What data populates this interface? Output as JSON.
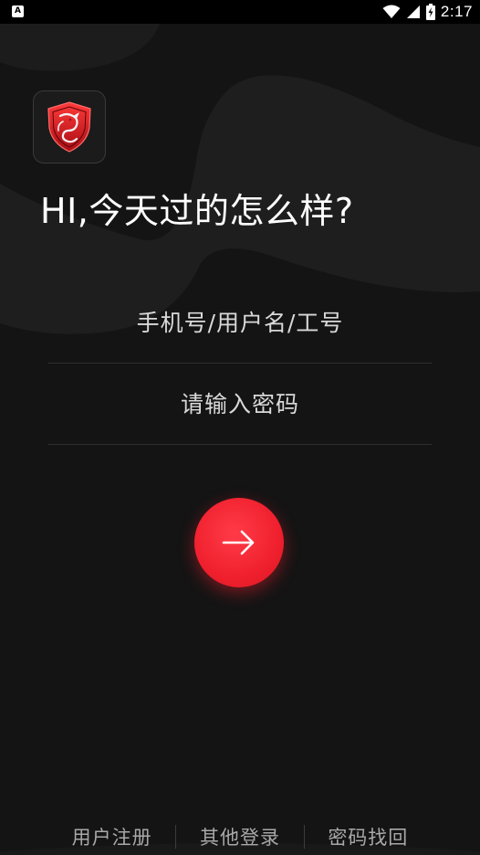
{
  "status_bar": {
    "app_notification_letter": "A",
    "time": "2:17",
    "icons": [
      "wifi-icon",
      "cell-signal-icon",
      "battery-icon"
    ]
  },
  "app": {
    "logo_icon": "msi-dragon-shield-icon",
    "greeting": "HI,今天过的怎么样?"
  },
  "login_form": {
    "username_placeholder": "手机号/用户名/工号",
    "username_value": "",
    "password_placeholder": "请输入密码",
    "password_value": "",
    "submit_icon": "arrow-right-icon"
  },
  "footer": {
    "links": [
      {
        "label": "用户注册"
      },
      {
        "label": "其他登录"
      },
      {
        "label": "密码找回"
      }
    ]
  },
  "colors": {
    "background": "#141414",
    "accent": "#f0202e",
    "text_primary": "#ffffff",
    "text_secondary": "#a8a8a8",
    "divider": "#2f2f2f"
  }
}
